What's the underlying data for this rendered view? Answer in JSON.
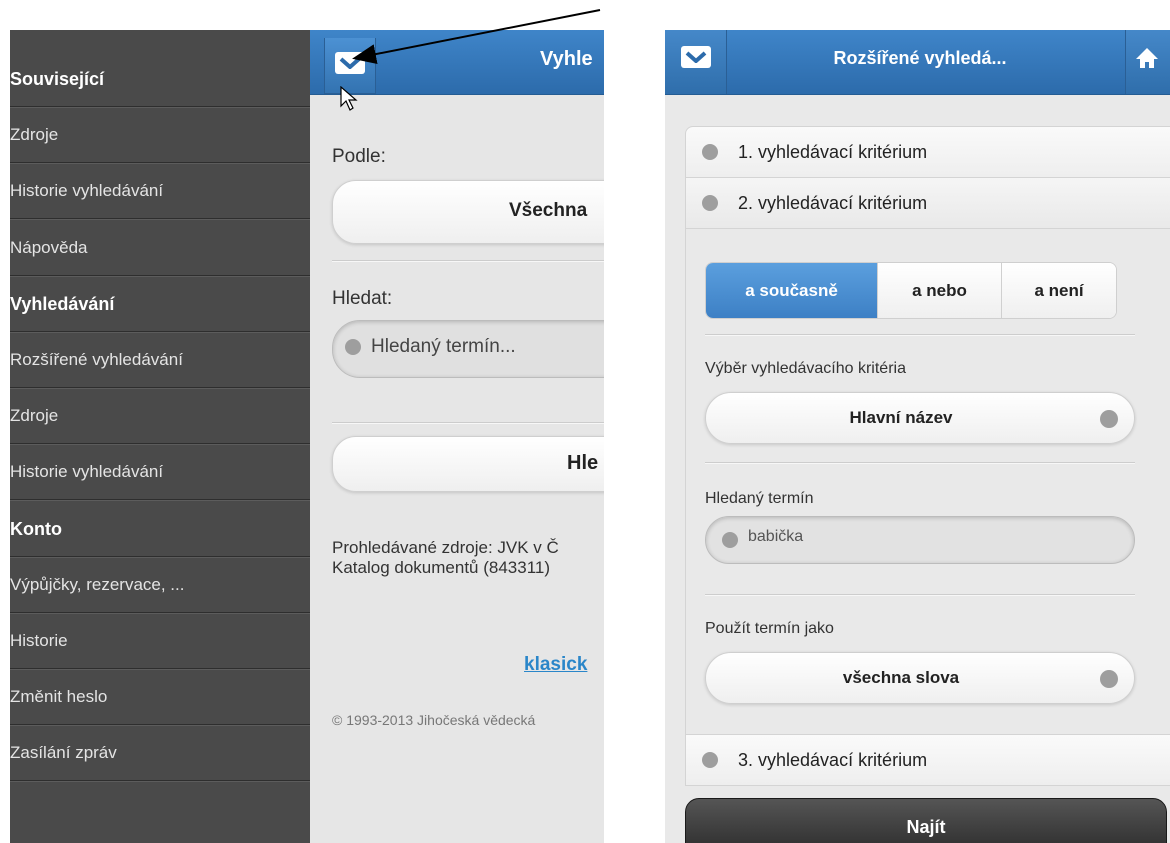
{
  "left": {
    "menu": [
      {
        "label": "Související",
        "heading": true
      },
      {
        "label": "Zdroje",
        "heading": false
      },
      {
        "label": "Historie vyhledávání",
        "heading": false
      },
      {
        "label": "Nápověda",
        "heading": false
      },
      {
        "label": "Vyhledávání",
        "heading": true
      },
      {
        "label": "Rozšířené vyhledávání",
        "heading": false
      },
      {
        "label": "Zdroje",
        "heading": false
      },
      {
        "label": "Historie vyhledávání",
        "heading": false
      },
      {
        "label": "Konto",
        "heading": true
      },
      {
        "label": "Výpůjčky, rezervace, ...",
        "heading": false
      },
      {
        "label": "Historie",
        "heading": false
      },
      {
        "label": "Změnit heslo",
        "heading": false
      },
      {
        "label": "Zasílání zpráv",
        "heading": false
      }
    ],
    "header_title": "Vyhle",
    "podle_label": "Podle:",
    "podle_value": "Všechna",
    "hledat_label": "Hledat:",
    "search_placeholder": "Hledaný termín...",
    "hledat_button": "Hle",
    "sources_line1": "Prohledávané zdroje: JVK v Č",
    "sources_line2": "Katalog dokumentů (843311)",
    "classic_link": "klasick",
    "footer": "© 1993-2013 Jihočeská vědecká"
  },
  "right": {
    "header_title": "Rozšířené vyhledá...",
    "criteria": [
      "1. vyhledávací kritérium",
      "2. vyhledávací kritérium",
      "3. vyhledávací kritérium"
    ],
    "operators": [
      "a současně",
      "a nebo",
      "a není"
    ],
    "operator_selected": "a současně",
    "criterion_label": "Výběr vyhledávacího kritéria",
    "criterion_value": "Hlavní název",
    "term_label": "Hledaný termín",
    "term_value": "babička",
    "use_as_label": "Použít termín jako",
    "use_as_value": "všechna slova",
    "submit": "Najít"
  }
}
